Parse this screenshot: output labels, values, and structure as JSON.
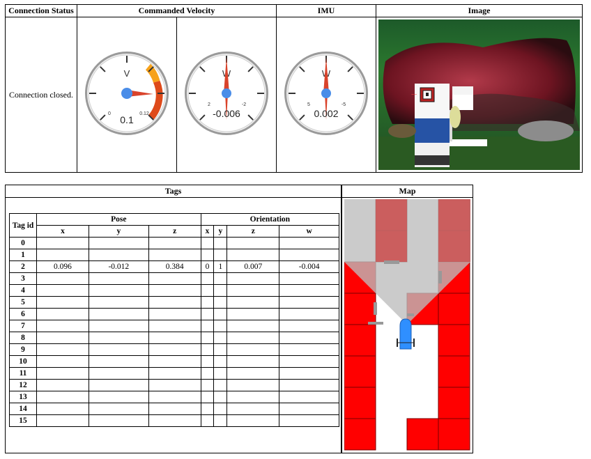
{
  "header": {
    "connection_status": "Connection Status",
    "commanded_velocity": "Commanded Velocity",
    "imu": "IMU",
    "image": "Image"
  },
  "status_text": "Connection closed.",
  "gauges": [
    {
      "symbol": "V",
      "value": "0.1",
      "min_label": "0",
      "max_label": "0.12"
    },
    {
      "symbol": "W",
      "value": "-0.006",
      "min_label": "2",
      "max_label": "-2"
    },
    {
      "symbol": "W",
      "value": "0.002",
      "min_label": "5",
      "max_label": "-5"
    }
  ],
  "tags": {
    "title": "Tags",
    "tag_id_header": "Tag id",
    "pose_header": "Pose",
    "orientation_header": "Orientation",
    "columns": [
      "x",
      "y",
      "z",
      "x",
      "y",
      "z",
      "w"
    ],
    "rows": [
      {
        "id": "0",
        "values": [
          "",
          "",
          "",
          "",
          "",
          "",
          ""
        ]
      },
      {
        "id": "1",
        "values": [
          "",
          "",
          "",
          "",
          "",
          "",
          ""
        ]
      },
      {
        "id": "2",
        "values": [
          "0.096",
          "-0.012",
          "0.384",
          "0",
          "1",
          "0.007",
          "-0.004"
        ]
      },
      {
        "id": "3",
        "values": [
          "",
          "",
          "",
          "",
          "",
          "",
          ""
        ]
      },
      {
        "id": "4",
        "values": [
          "",
          "",
          "",
          "",
          "",
          "",
          ""
        ]
      },
      {
        "id": "5",
        "values": [
          "",
          "",
          "",
          "",
          "",
          "",
          ""
        ]
      },
      {
        "id": "6",
        "values": [
          "",
          "",
          "",
          "",
          "",
          "",
          ""
        ]
      },
      {
        "id": "7",
        "values": [
          "",
          "",
          "",
          "",
          "",
          "",
          ""
        ]
      },
      {
        "id": "8",
        "values": [
          "",
          "",
          "",
          "",
          "",
          "",
          ""
        ]
      },
      {
        "id": "9",
        "values": [
          "",
          "",
          "",
          "",
          "",
          "",
          ""
        ]
      },
      {
        "id": "10",
        "values": [
          "",
          "",
          "",
          "",
          "",
          "",
          ""
        ]
      },
      {
        "id": "11",
        "values": [
          "",
          "",
          "",
          "",
          "",
          "",
          ""
        ]
      },
      {
        "id": "12",
        "values": [
          "",
          "",
          "",
          "",
          "",
          "",
          ""
        ]
      },
      {
        "id": "13",
        "values": [
          "",
          "",
          "",
          "",
          "",
          "",
          ""
        ]
      },
      {
        "id": "14",
        "values": [
          "",
          "",
          "",
          "",
          "",
          "",
          ""
        ]
      },
      {
        "id": "15",
        "values": [
          "",
          "",
          "",
          "",
          "",
          "",
          ""
        ]
      }
    ]
  },
  "map": {
    "title": "Map"
  },
  "colors": {
    "wall_red": "#ff0000",
    "grid_line": "#7a0000",
    "view_cone": "#b8b8b8",
    "robot_blue": "#2f8fff",
    "needle": "#d9432b",
    "gauge_hub": "#4a8de8"
  }
}
